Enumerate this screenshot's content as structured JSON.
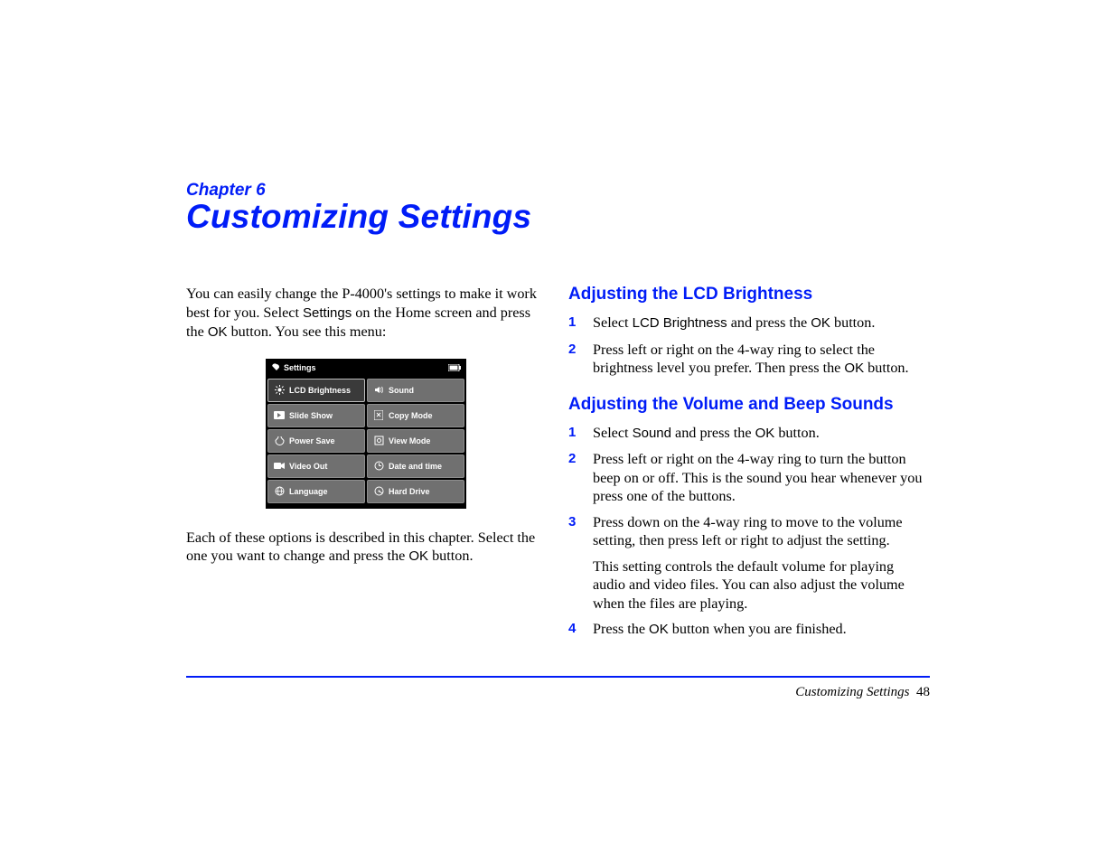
{
  "chapter_line": "Chapter 6",
  "chapter_title": "Customizing Settings",
  "left": {
    "p1_a": "You can easily change the P-4000's settings to make it work best for you. Select ",
    "p1_b": "Settings",
    "p1_c": " on the Home screen and press the ",
    "p1_d": "OK",
    "p1_e": " button. You see this menu:",
    "p2_a": "Each of these options is described in this chapter. Select the one you want to change and press the ",
    "p2_b": "OK",
    "p2_c": " button."
  },
  "settings_menu": {
    "title": "Settings",
    "items": [
      {
        "label": "LCD Brightness",
        "icon": "sun"
      },
      {
        "label": "Sound",
        "icon": "speaker"
      },
      {
        "label": "Slide Show",
        "icon": "slideshow"
      },
      {
        "label": "Copy Mode",
        "icon": "copy"
      },
      {
        "label": "Power Save",
        "icon": "power"
      },
      {
        "label": "View Mode",
        "icon": "view"
      },
      {
        "label": "Video Out",
        "icon": "video"
      },
      {
        "label": "Date and time",
        "icon": "clock"
      },
      {
        "label": "Language",
        "icon": "globe"
      },
      {
        "label": "Hard Drive",
        "icon": "hdd"
      }
    ]
  },
  "right": {
    "h1": "Adjusting the LCD Brightness",
    "s1l1_a": "Select ",
    "s1l1_b": "LCD Brightness",
    "s1l1_c": " and press the ",
    "s1l1_d": "OK",
    "s1l1_e": " button.",
    "s1l2_a": "Press left or right on the 4-way ring to select the brightness level you prefer. Then press the ",
    "s1l2_b": "OK",
    "s1l2_c": " button.",
    "h2": "Adjusting the Volume and Beep Sounds",
    "s2l1_a": "Select ",
    "s2l1_b": "Sound",
    "s2l1_c": " and press the ",
    "s2l1_d": "OK",
    "s2l1_e": " button.",
    "s2l2": "Press left or right on the 4-way ring to turn the button beep on or off. This is the sound you hear whenever you press one of the buttons.",
    "s2l3": "Press down on the 4-way ring to move to the volume setting, then press left or right to adjust the setting.",
    "s2l3b": "This setting controls the default volume for playing audio and video files. You can also adjust the volume when the files are playing.",
    "s2l4_a": "Press the ",
    "s2l4_b": "OK",
    "s2l4_c": " button when you are finished."
  },
  "footer": {
    "label": "Customizing Settings",
    "page": "48"
  }
}
